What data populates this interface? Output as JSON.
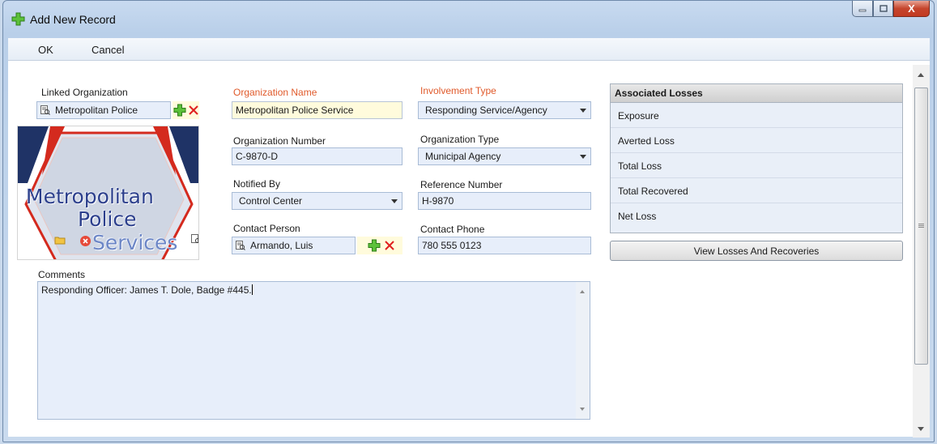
{
  "window": {
    "title": "Add New Record",
    "icon": "green-plus-icon",
    "close_glyph": "X"
  },
  "menu": {
    "ok": "OK",
    "cancel": "Cancel"
  },
  "form": {
    "linked_organization": {
      "label": "Linked Organization",
      "value": "Metropolitan Police"
    },
    "organization_name": {
      "label": "Organization Name",
      "value": "Metropolitan Police Service"
    },
    "involvement_type": {
      "label": "Involvement Type",
      "value": "Responding Service/Agency"
    },
    "organization_number": {
      "label": "Organization Number",
      "value": "C-9870-D"
    },
    "organization_type": {
      "label": "Organization Type",
      "value": "Municipal Agency"
    },
    "notified_by": {
      "label": "Notified By",
      "value": "Control Center"
    },
    "reference_number": {
      "label": "Reference Number",
      "value": "H-9870"
    },
    "contact_person": {
      "label": "Contact Person",
      "value": "Armando, Luis"
    },
    "contact_phone": {
      "label": "Contact Phone",
      "value": "780 555 0123"
    },
    "comments": {
      "label": "Comments",
      "value": "Responding Officer: James T. Dole, Badge #445."
    }
  },
  "logo": {
    "line1": "Metropolitan",
    "line2": "Police",
    "line3": "Services",
    "colors": {
      "text": "#2c3f8c",
      "frame": "#d42a1e",
      "navy": "#1f3366"
    }
  },
  "associated_losses": {
    "header": "Associated Losses",
    "rows": [
      "Exposure",
      "Averted Loss",
      "Total Loss",
      "Total Recovered",
      "Net Loss"
    ]
  },
  "buttons": {
    "view_losses": "View Losses And Recoveries"
  },
  "colors": {
    "required_label": "#e05a2b",
    "field_background": "#e7eefa",
    "highlight_field": "#fffbdc",
    "add_icon": "#4caf2a",
    "remove_icon": "#e02020"
  }
}
